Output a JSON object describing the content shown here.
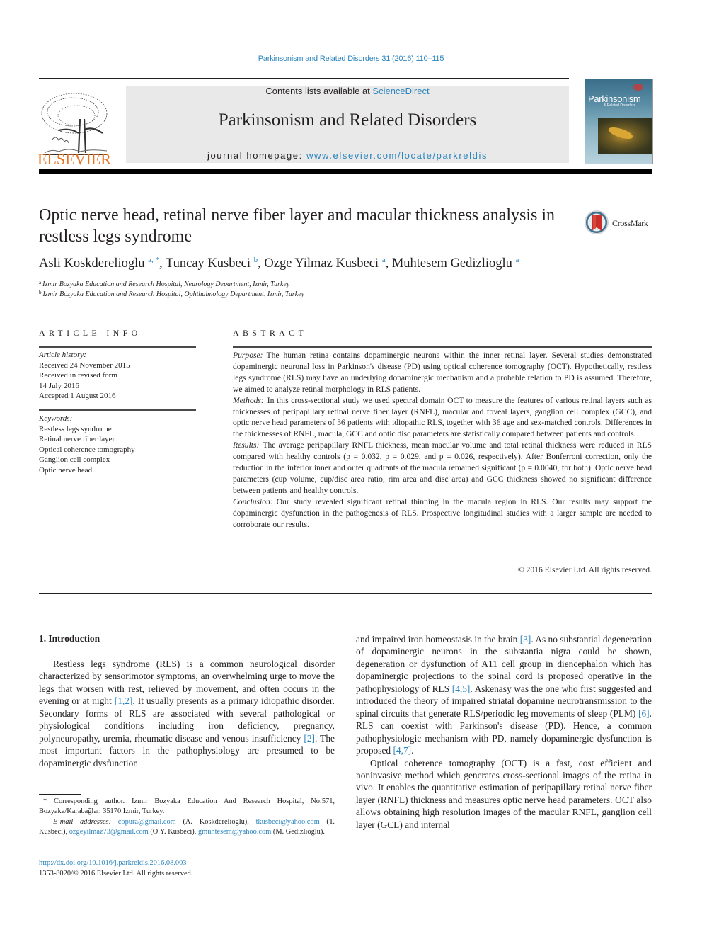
{
  "running_head": "Parkinsonism and Related Disorders 31 (2016) 110–115",
  "masthead": {
    "publisher_logo_text": "ELSEVIER",
    "contents_prefix": "Contents lists available at ",
    "contents_link": "ScienceDirect",
    "journal_name": "Parkinsonism and Related Disorders",
    "homepage_prefix": "journal homepage: ",
    "homepage_link": "www.elsevier.com/locate/parkreldis",
    "cover_title": "Parkinsonism",
    "cover_subtitle": "& Related Disorders"
  },
  "article": {
    "title": "Optic nerve head, retinal nerve fiber layer and macular thickness analysis in restless legs syndrome",
    "crossmark_label": "CrossMark",
    "authors": [
      {
        "name": "Asli Koskderelioglu",
        "sup": "a, *"
      },
      {
        "name": "Tuncay Kusbeci",
        "sup": "b"
      },
      {
        "name": "Ozge Yilmaz Kusbeci",
        "sup": "a"
      },
      {
        "name": "Muhtesem Gedizlioglu",
        "sup": "a"
      }
    ],
    "affiliations": [
      {
        "mark": "a",
        "text": "Izmir Bozyaka Education and Research Hospital, Neurology Department, Izmir, Turkey"
      },
      {
        "mark": "b",
        "text": "Izmir Bozyaka Education and Research Hospital, Ophthalmology Department, Izmir, Turkey"
      }
    ]
  },
  "article_info": {
    "heading": "ARTICLE INFO",
    "history_label": "Article history:",
    "history": [
      "Received 24 November 2015",
      "Received in revised form",
      "14 July 2016",
      "Accepted 1 August 2016"
    ],
    "keywords_label": "Keywords:",
    "keywords": [
      "Restless legs syndrome",
      "Retinal nerve fiber layer",
      "Optical coherence tomography",
      "Ganglion cell complex",
      "Optic nerve head"
    ]
  },
  "abstract": {
    "heading": "ABSTRACT",
    "sections": [
      {
        "label": "Purpose:",
        "text": "The human retina contains dopaminergic neurons within the inner retinal layer. Several studies demonstrated dopaminergic neuronal loss in Parkinson's disease (PD) using optical coherence tomog­raphy (OCT). Hypothetically, restless legs syndrome (RLS) may have an underlying dopaminergic mechanism and a probable relation to PD is assumed. Therefore, we aimed to analyze retinal morphology in RLS patients."
      },
      {
        "label": "Methods:",
        "text": "In this cross-sectional study we used spectral domain OCT to measure the features of various retinal layers such as thicknesses of peripapillary retinal nerve fiber layer (RNFL), macular and foveal layers, ganglion cell complex (GCC), and optic nerve head parameters of 36 patients with idiopathic RLS, together with 36 age and sex-matched controls. Differences in the thicknesses of RNFL, macula, GCC and optic disc parameters are statistically compared between patients and controls."
      },
      {
        "label": "Results:",
        "text": "The average peripapillary RNFL thickness, mean macular volume and total retinal thickness were reduced in RLS compared with healthy controls (p = 0.032, p = 0.029, and p = 0.026, respectively). After Bonferroni correction, only the reduction in the inferior inner and outer quadrants of the macula remained significant (p = 0.0040, for both). Optic nerve head parameters (cup volume, cup/disc area ratio, rim area and disc area) and GCC thickness showed no significant difference between patients and healthy controls."
      },
      {
        "label": "Conclusion:",
        "text": "Our study revealed significant retinal thinning in the macula region in RLS. Our results may support the dopaminergic dysfunction in the pathogenesis of RLS. Prospective longitudinal studies with a larger sample are needed to corroborate our results."
      }
    ],
    "copyright": "© 2016 Elsevier Ltd. All rights reserved."
  },
  "body": {
    "section_heading": "1.  Introduction",
    "left_column": [
      {
        "text": "Restless legs syndrome (RLS) is a common neurological disorder characterized by sensorimotor symptoms, an overwhelming urge to move the legs that worsen with rest, relieved by movement, and often occurs in the evening or at night ",
        "ref": "[1,2]",
        "after": ". It usually presents as a primary idiopathic disorder. Secondary forms of RLS are associated with several pathological or physiological conditions including iron deficiency, pregnancy, polyneuropathy, uremia, rheumatic disease and venous insufficiency ",
        "ref2": "[2]",
        "after2": ". The most important factors in the pathophysiology are presumed to be dopaminergic dysfunction"
      }
    ],
    "right_column": {
      "p1": {
        "t1": "and impaired iron homeostasis in the brain ",
        "r1": "[3]",
        "t2": ". As no substantial degeneration of dopaminergic neurons in the substantia nigra could be shown, degeneration or dysfunction of A11 cell group in diencephalon which has dopaminergic projections to the spinal cord is proposed operative in the pathophysiology of RLS ",
        "r2": "[4,5]",
        "t3": ". Askenasy was the one who first suggested and introduced the theory of impaired striatal dopamine neurotransmission to the spinal circuits that generate RLS/periodic leg movements of sleep (PLM) ",
        "r3": "[6]",
        "t4": ". RLS can coexist with Parkinson's disease (PD). Hence, a common pathophysiologic mechanism with PD, namely dopami­nergic dysfunction is proposed ",
        "r4": "[4,7]",
        "t5": "."
      },
      "p2": "Optical coherence tomography (OCT) is a fast, cost efficient and noninvasive method which generates cross-sectional images of the retina in vivo. It enables the quantitative estimation of peripapillary retinal nerve fiber layer (RNFL) thickness and measures optic nerve head parameters. OCT also allows obtaining high resolution images of the macular RNFL, ganglion cell layer (GCL) and internal"
    }
  },
  "footnotes": {
    "corresponding": "* Corresponding author. Izmir Bozyaka Education And Research Hospital, No:571, Bozyaka/Karabağlar, 35170 Izmir, Turkey.",
    "email_label": "E-mail addresses:",
    "emails": [
      {
        "address": "copura@gmail.com",
        "owner": " (A. Koskderelioglu), "
      },
      {
        "address": "tkusbeci@yahoo.com",
        "owner": " (T. Kusbeci), "
      },
      {
        "address": "ozgeyilmaz73@gmail.com",
        "owner": " (O.Y. Kusbeci), "
      },
      {
        "address": "gmuhtesem@yahoo.com",
        "owner": " (M. Gedizlioglu)."
      }
    ],
    "doi": "http://dx.doi.org/10.1016/j.parkreldis.2016.08.003",
    "issn_line": "1353-8020/© 2016 Elsevier Ltd. All rights reserved."
  }
}
